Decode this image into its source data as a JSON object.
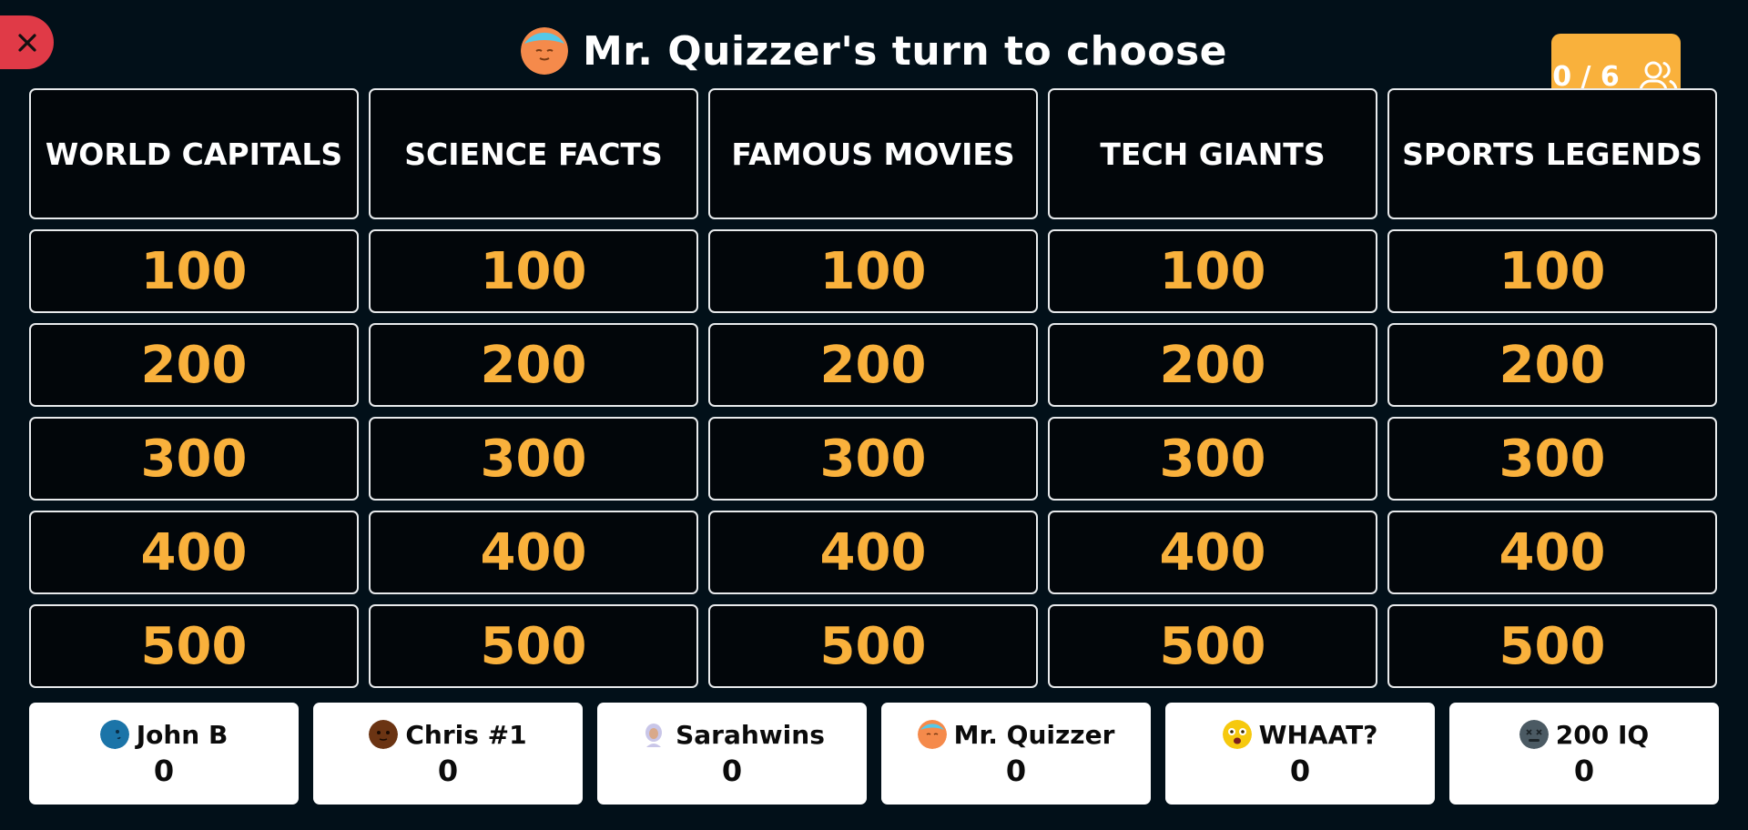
{
  "header": {
    "title": "Mr. Quizzer's turn to choose",
    "avatar_icon": "orange-face-avatar-icon"
  },
  "player_count": {
    "label": "0 / 6",
    "icon": "users-icon"
  },
  "board": {
    "categories": [
      {
        "name": "WORLD CAPITALS",
        "values": [
          "100",
          "200",
          "300",
          "400",
          "500"
        ]
      },
      {
        "name": "SCIENCE FACTS",
        "values": [
          "100",
          "200",
          "300",
          "400",
          "500"
        ]
      },
      {
        "name": "FAMOUS MOVIES",
        "values": [
          "100",
          "200",
          "300",
          "400",
          "500"
        ]
      },
      {
        "name": "TECH GIANTS",
        "values": [
          "100",
          "200",
          "300",
          "400",
          "500"
        ]
      },
      {
        "name": "SPORTS LEGENDS",
        "values": [
          "100",
          "200",
          "300",
          "400",
          "500"
        ]
      }
    ]
  },
  "players": [
    {
      "name": "John B",
      "score": "0",
      "avatar_color": "#1b74a8",
      "avatar_icon": "blue-face-avatar-icon"
    },
    {
      "name": "Chris #1",
      "score": "0",
      "avatar_color": "#6b3413",
      "avatar_icon": "brown-face-avatar-icon"
    },
    {
      "name": "Sarahwins",
      "score": "0",
      "avatar_color": "#dcdcf0",
      "avatar_icon": "person-avatar-icon"
    },
    {
      "name": "Mr. Quizzer",
      "score": "0",
      "avatar_color": "#f58a4b",
      "avatar_icon": "orange-face-avatar-icon"
    },
    {
      "name": "WHAAT?",
      "score": "0",
      "avatar_color": "#f6c90e",
      "avatar_icon": "shocked-emoji-avatar-icon"
    },
    {
      "name": "200 IQ",
      "score": "0",
      "avatar_color": "#4b5a63",
      "avatar_icon": "grey-face-avatar-icon"
    }
  ],
  "colors": {
    "background": "#021019",
    "accent": "#f9b13c",
    "close": "#e03a47",
    "cell_border": "#e8eaec"
  }
}
